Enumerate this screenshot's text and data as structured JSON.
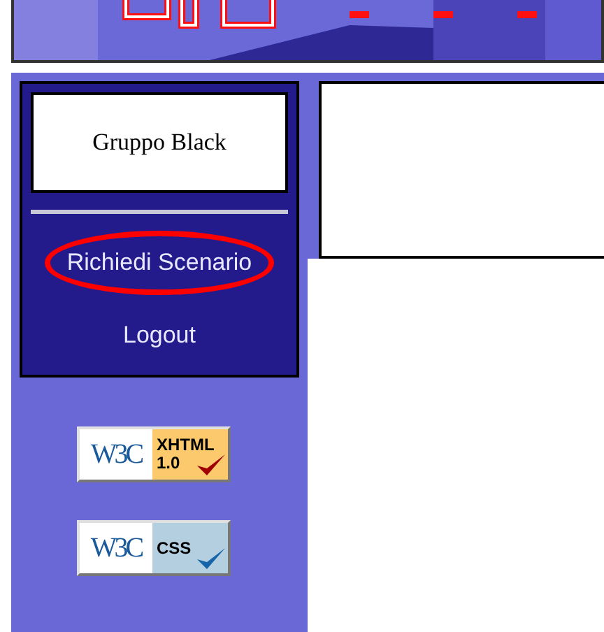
{
  "sidebar": {
    "group_name": "Gruppo Black",
    "links": [
      {
        "label": "Richiedi Scenario",
        "highlighted": true
      },
      {
        "label": "Logout",
        "highlighted": false
      }
    ]
  },
  "badges": [
    {
      "kind": "xhtml",
      "logo": "W3C",
      "label": "XHTML",
      "version": "1.0",
      "color": "#fcc96c"
    },
    {
      "kind": "css",
      "logo": "W3C",
      "label": "CSS",
      "color": "#b4cfe0"
    }
  ]
}
